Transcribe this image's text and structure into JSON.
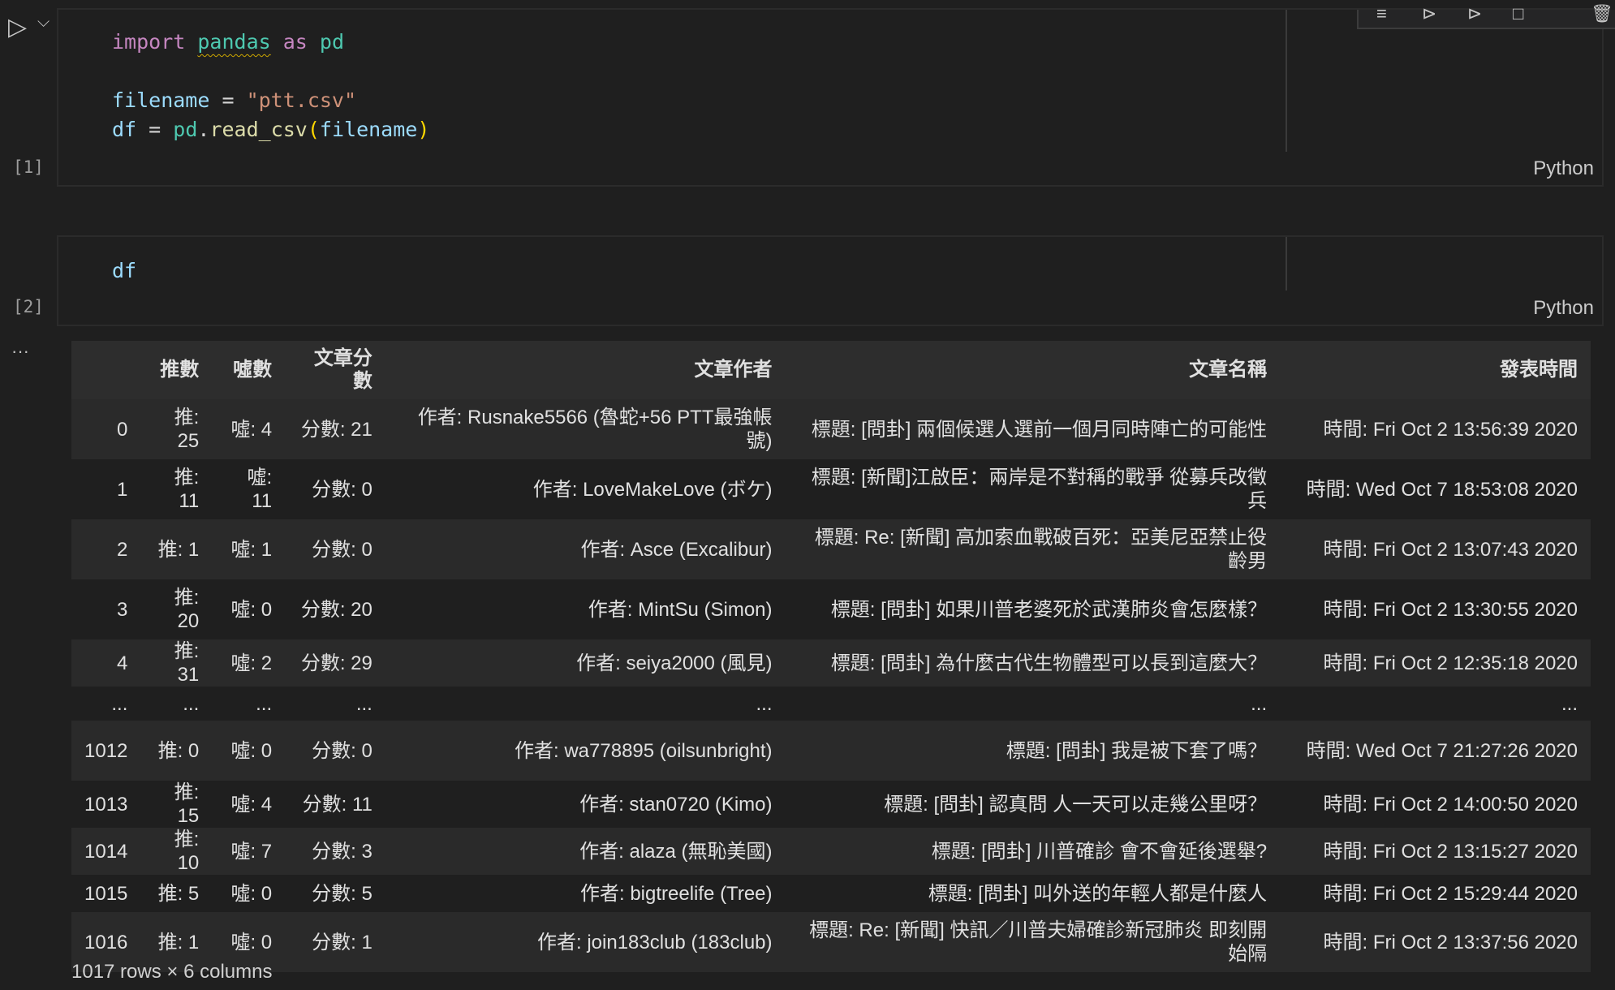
{
  "cell1": {
    "exec_count": "[1]",
    "language": "Python",
    "code": {
      "import_kw": "import",
      "module": "pandas",
      "as_kw": "as",
      "alias": "pd",
      "var1": "filename",
      "eq1": " = ",
      "string": "\"ptt.csv\"",
      "var2": "df",
      "eq2": " = ",
      "obj": "pd",
      "dot": ".",
      "func": "read_csv",
      "lparen": "(",
      "arg": "filename",
      "rparen": ")"
    }
  },
  "cell2": {
    "exec_count": "[2]",
    "language": "Python",
    "code": {
      "var": "df"
    }
  },
  "output": {
    "ellipsis": "···",
    "columns": [
      "",
      "推數",
      "噓數",
      "文章分數",
      "文章作者",
      "文章名稱",
      "發表時間"
    ],
    "rows": [
      [
        "0",
        "推: 25",
        "噓: 4",
        "分數: 21",
        "作者: Rusnake5566 (魯蛇+56 PTT最強帳號)",
        "標題: [問卦] 兩個候選人選前一個月同時陣亡的可能性",
        "時間: Fri Oct 2 13:56:39 2020"
      ],
      [
        "1",
        "推: 11",
        "噓: 11",
        "分數: 0",
        "作者: LoveMakeLove (ボケ)",
        "標題: [新聞]江啟臣：兩岸是不對稱的戰爭 從募兵改徵兵",
        "時間: Wed Oct 7 18:53:08 2020"
      ],
      [
        "2",
        "推: 1",
        "噓: 1",
        "分數: 0",
        "作者: Asce (Excalibur)",
        "標題: Re: [新聞] 高加索血戰破百死：亞美尼亞禁止役齡男",
        "時間: Fri Oct 2 13:07:43 2020"
      ],
      [
        "3",
        "推: 20",
        "噓: 0",
        "分數: 20",
        "作者: MintSu (Simon)",
        "標題: [問卦] 如果川普老婆死於武漢肺炎會怎麼樣？",
        "時間: Fri Oct 2 13:30:55 2020"
      ],
      [
        "4",
        "推: 31",
        "噓: 2",
        "分數: 29",
        "作者: seiya2000 (風見)",
        "標題: [問卦] 為什麼古代生物體型可以長到這麼大？",
        "時間: Fri Oct 2 12:35:18 2020"
      ],
      [
        "...",
        "...",
        "...",
        "...",
        "...",
        "...",
        "..."
      ],
      [
        "1012",
        "推: 0",
        "噓: 0",
        "分數: 0",
        "作者: wa778895 (oilsunbright)",
        "標題: [問卦] 我是被下套了嗎？",
        "時間: Wed Oct 7 21:27:26 2020"
      ],
      [
        "1013",
        "推: 15",
        "噓: 4",
        "分數: 11",
        "作者: stan0720 (Kimo)",
        "標題: [問卦] 認真問 人一天可以走幾公里呀？",
        "時間: Fri Oct 2 14:00:50 2020"
      ],
      [
        "1014",
        "推: 10",
        "噓: 7",
        "分數: 3",
        "作者: alaza (無恥美國)",
        "標題: [問卦] 川普確診 會不會延後選舉?",
        "時間: Fri Oct 2 13:15:27 2020"
      ],
      [
        "1015",
        "推: 5",
        "噓: 0",
        "分數: 5",
        "作者: bigtreelife (Tree)",
        "標題: [問卦] 叫外送的年輕人都是什麼人",
        "時間: Fri Oct 2 15:29:44 2020"
      ],
      [
        "1016",
        "推: 1",
        "噓: 0",
        "分數: 1",
        "作者: join183club (183club)",
        "標題: Re: [新聞] 快訊／川普夫婦確診新冠肺炎 即刻開始隔",
        "時間: Fri Oct 2 13:37:56 2020"
      ]
    ],
    "summary": "1017 rows × 6 columns"
  },
  "icons": {
    "run": "▷",
    "chevron": "⌵",
    "toolbar": [
      "≡",
      "⊳",
      "⊳",
      "□",
      "🗑"
    ]
  }
}
